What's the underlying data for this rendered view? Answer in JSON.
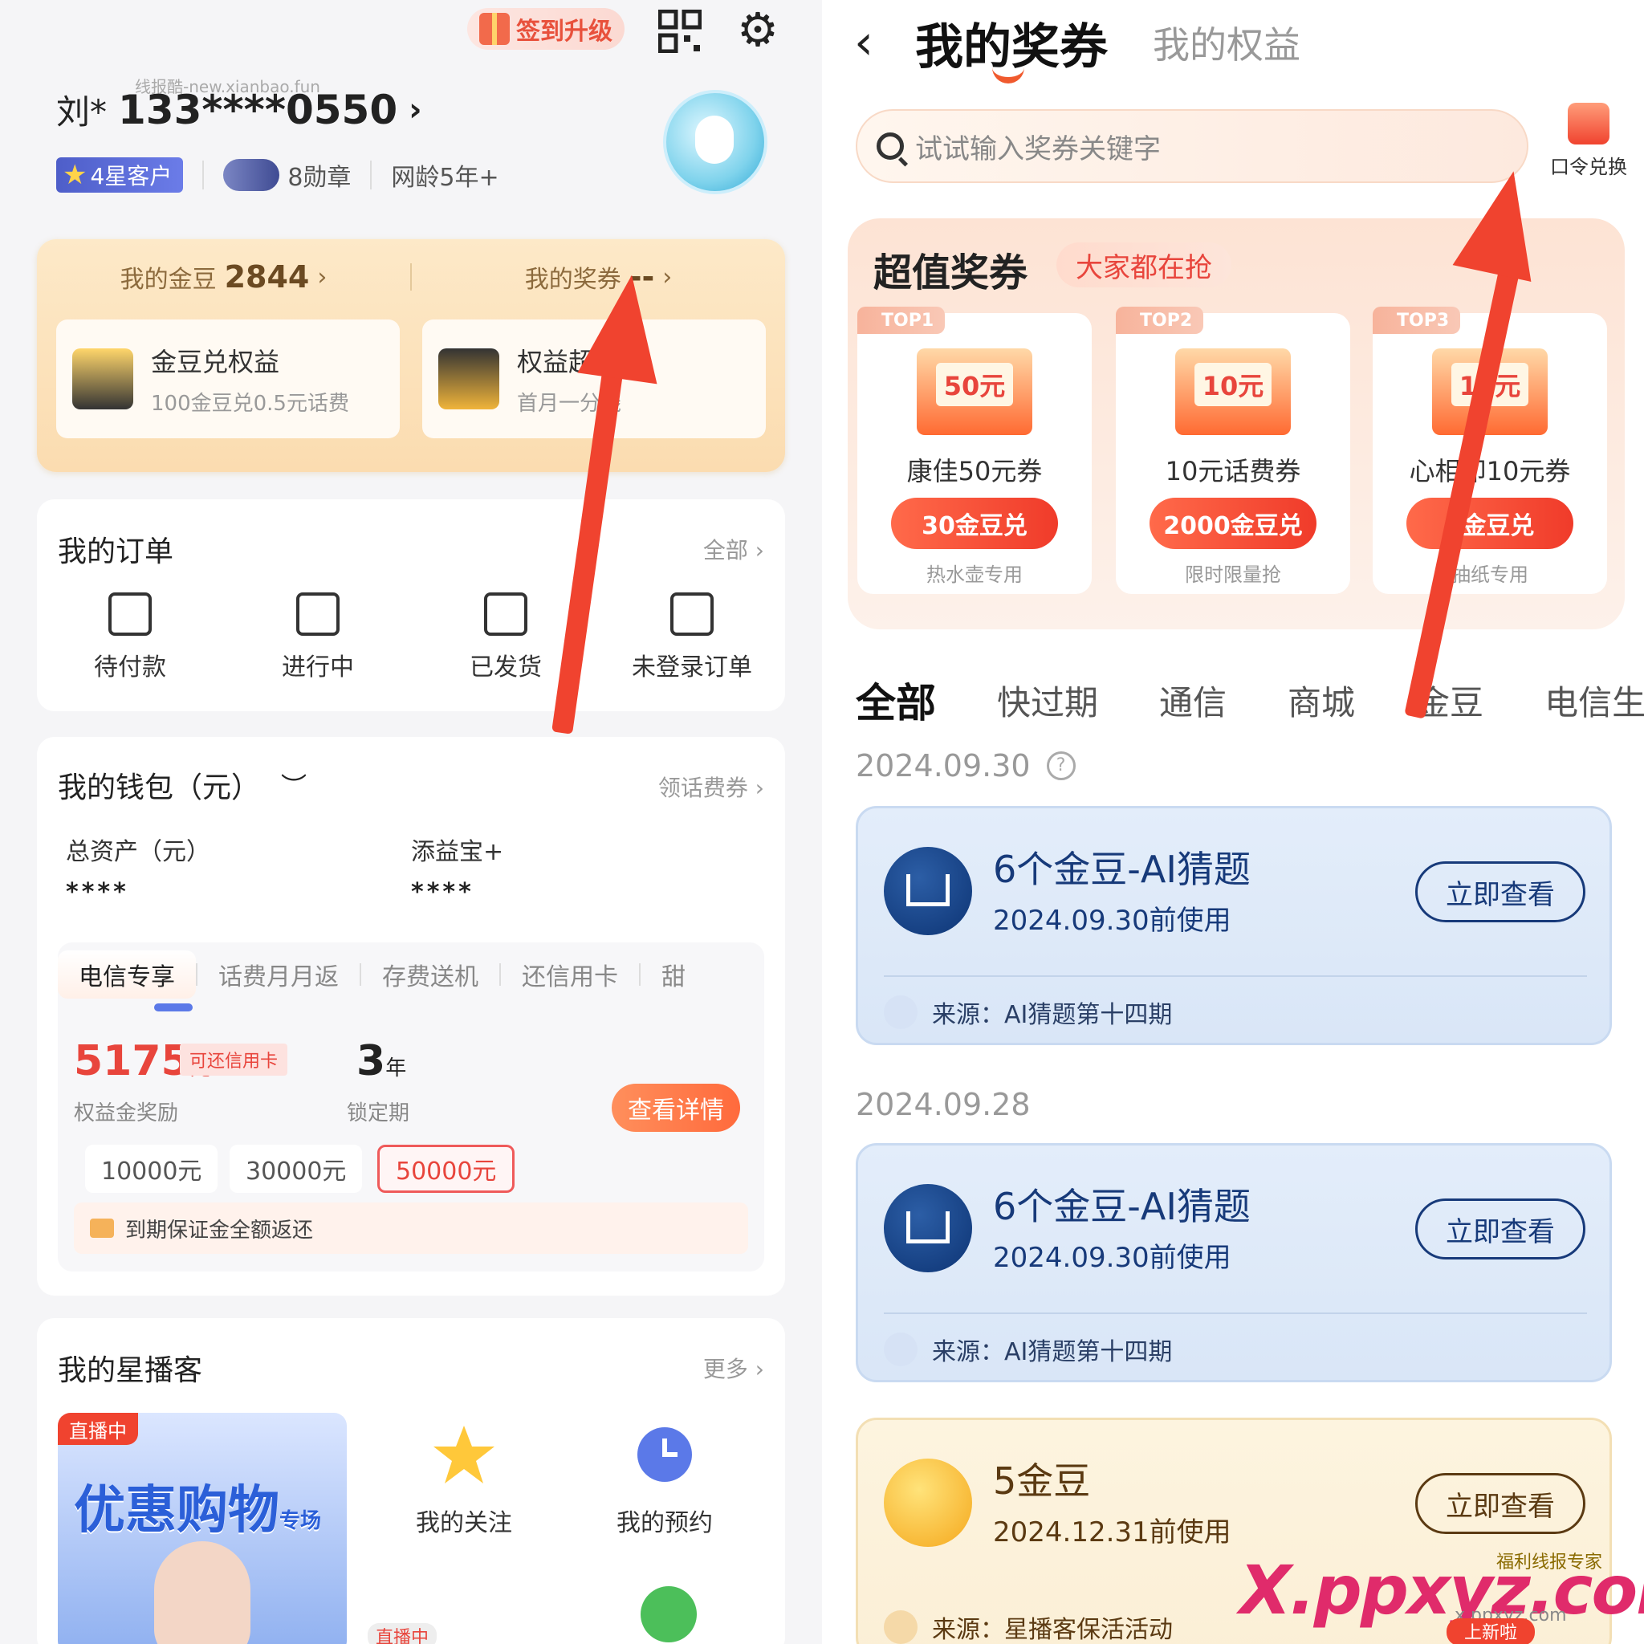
{
  "left": {
    "watermark_small": "线报酷-new.xianbao.fun",
    "signin_label": "签到升级",
    "user": {
      "name": "刘*",
      "phone": "133****0550"
    },
    "badges": {
      "level": "4星客户",
      "medals": "8勋章",
      "network_age": "网龄5年+"
    },
    "gold": {
      "beans_label": "我的金豆",
      "beans_value": "2844",
      "coupons_label": "我的奖券",
      "coupons_value": "--",
      "card1_title": "金豆兑权益",
      "card1_sub": "100金豆兑0.5元话费",
      "card2_title": "权益超值",
      "card2_sub": "首月一分钱"
    },
    "orders": {
      "title": "我的订单",
      "more": "全部",
      "items": [
        "待付款",
        "进行中",
        "已发货",
        "未登录订单"
      ]
    },
    "wallet": {
      "title": "我的钱包（元）",
      "more": "领话费券",
      "total_label": "总资产（元）",
      "total_value": "****",
      "tyb_label": "添益宝+",
      "tyb_value": "****",
      "tabs": [
        "电信专享",
        "话费月月返",
        "存费送机",
        "还信用卡",
        "甜"
      ],
      "reward_value": "5175",
      "reward_unit": "元",
      "reward_tag": "可还信用卡",
      "reward_label": "权益金奖励",
      "lock_value": "3",
      "lock_unit": "年",
      "lock_label": "锁定期",
      "detail_btn": "查看详情",
      "chips": [
        "10000元",
        "30000元",
        "50000元"
      ],
      "notice": "到期保证金全额返还"
    },
    "live": {
      "title": "我的星播客",
      "more": "更多",
      "live_tag": "直播中",
      "banner_text": "优惠购物",
      "banner_side": "专场",
      "follow": "我的关注",
      "reserve": "我的预约",
      "live_tag2": "直播中"
    }
  },
  "right": {
    "title": "我的奖券",
    "title2": "我的权益",
    "search_placeholder": "试试输入奖券关键字",
    "redeem_label": "口令兑换",
    "super_title": "超值奖券",
    "super_tag": "大家都在抢",
    "coupons": [
      {
        "rank": "TOP1",
        "face": "50元",
        "name": "康佳50元券",
        "price": "30金豆兑",
        "sub": "热水壶专用"
      },
      {
        "rank": "TOP2",
        "face": "10元",
        "name": "10元话费券",
        "price": "2000金豆兑",
        "sub": "限时限量抢"
      },
      {
        "rank": "TOP3",
        "face": "10元",
        "name": "心相印10元券",
        "price": "3金豆兑",
        "sub": "抽纸专用"
      }
    ],
    "categories": [
      "全部",
      "快过期",
      "通信",
      "商城",
      "金豆",
      "电信生活"
    ],
    "date1": "2024.09.30",
    "date2": "2024.09.28",
    "vouchers": [
      {
        "name": "6个金豆-AI猜题",
        "expiry": "2024.09.30前使用",
        "btn": "立即查看",
        "source": "来源：AI猜题第十四期"
      },
      {
        "name": "6个金豆-AI猜题",
        "expiry": "2024.09.30前使用",
        "btn": "立即查看",
        "source": "来源：AI猜题第十四期"
      },
      {
        "name": "5金豆",
        "expiry": "2024.12.31前使用",
        "btn": "立即查看",
        "source": "来源：星播客保活活动"
      }
    ],
    "watermark": {
      "brand": "X.ppxyz.com",
      "tag": "福利线报专家",
      "url": "x.ppxyz.com",
      "badge": "上新啦"
    }
  },
  "colors": {
    "accent_red": "#f0432f",
    "gold_bg": "#fde9c8",
    "voucher_blue": "#e3edfa",
    "voucher_gold": "#fdf4df"
  }
}
